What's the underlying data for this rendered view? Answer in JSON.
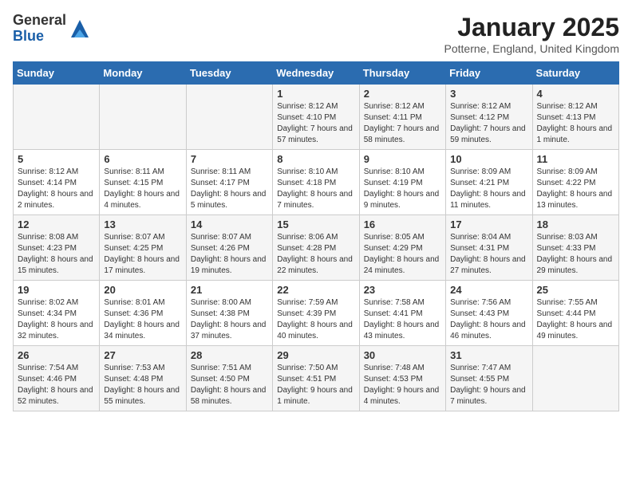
{
  "header": {
    "logo_general": "General",
    "logo_blue": "Blue",
    "title": "January 2025",
    "location": "Potterne, England, United Kingdom"
  },
  "days_of_week": [
    "Sunday",
    "Monday",
    "Tuesday",
    "Wednesday",
    "Thursday",
    "Friday",
    "Saturday"
  ],
  "weeks": [
    [
      {
        "day": "",
        "info": ""
      },
      {
        "day": "",
        "info": ""
      },
      {
        "day": "",
        "info": ""
      },
      {
        "day": "1",
        "info": "Sunrise: 8:12 AM\nSunset: 4:10 PM\nDaylight: 7 hours and 57 minutes."
      },
      {
        "day": "2",
        "info": "Sunrise: 8:12 AM\nSunset: 4:11 PM\nDaylight: 7 hours and 58 minutes."
      },
      {
        "day": "3",
        "info": "Sunrise: 8:12 AM\nSunset: 4:12 PM\nDaylight: 7 hours and 59 minutes."
      },
      {
        "day": "4",
        "info": "Sunrise: 8:12 AM\nSunset: 4:13 PM\nDaylight: 8 hours and 1 minute."
      }
    ],
    [
      {
        "day": "5",
        "info": "Sunrise: 8:12 AM\nSunset: 4:14 PM\nDaylight: 8 hours and 2 minutes."
      },
      {
        "day": "6",
        "info": "Sunrise: 8:11 AM\nSunset: 4:15 PM\nDaylight: 8 hours and 4 minutes."
      },
      {
        "day": "7",
        "info": "Sunrise: 8:11 AM\nSunset: 4:17 PM\nDaylight: 8 hours and 5 minutes."
      },
      {
        "day": "8",
        "info": "Sunrise: 8:10 AM\nSunset: 4:18 PM\nDaylight: 8 hours and 7 minutes."
      },
      {
        "day": "9",
        "info": "Sunrise: 8:10 AM\nSunset: 4:19 PM\nDaylight: 8 hours and 9 minutes."
      },
      {
        "day": "10",
        "info": "Sunrise: 8:09 AM\nSunset: 4:21 PM\nDaylight: 8 hours and 11 minutes."
      },
      {
        "day": "11",
        "info": "Sunrise: 8:09 AM\nSunset: 4:22 PM\nDaylight: 8 hours and 13 minutes."
      }
    ],
    [
      {
        "day": "12",
        "info": "Sunrise: 8:08 AM\nSunset: 4:23 PM\nDaylight: 8 hours and 15 minutes."
      },
      {
        "day": "13",
        "info": "Sunrise: 8:07 AM\nSunset: 4:25 PM\nDaylight: 8 hours and 17 minutes."
      },
      {
        "day": "14",
        "info": "Sunrise: 8:07 AM\nSunset: 4:26 PM\nDaylight: 8 hours and 19 minutes."
      },
      {
        "day": "15",
        "info": "Sunrise: 8:06 AM\nSunset: 4:28 PM\nDaylight: 8 hours and 22 minutes."
      },
      {
        "day": "16",
        "info": "Sunrise: 8:05 AM\nSunset: 4:29 PM\nDaylight: 8 hours and 24 minutes."
      },
      {
        "day": "17",
        "info": "Sunrise: 8:04 AM\nSunset: 4:31 PM\nDaylight: 8 hours and 27 minutes."
      },
      {
        "day": "18",
        "info": "Sunrise: 8:03 AM\nSunset: 4:33 PM\nDaylight: 8 hours and 29 minutes."
      }
    ],
    [
      {
        "day": "19",
        "info": "Sunrise: 8:02 AM\nSunset: 4:34 PM\nDaylight: 8 hours and 32 minutes."
      },
      {
        "day": "20",
        "info": "Sunrise: 8:01 AM\nSunset: 4:36 PM\nDaylight: 8 hours and 34 minutes."
      },
      {
        "day": "21",
        "info": "Sunrise: 8:00 AM\nSunset: 4:38 PM\nDaylight: 8 hours and 37 minutes."
      },
      {
        "day": "22",
        "info": "Sunrise: 7:59 AM\nSunset: 4:39 PM\nDaylight: 8 hours and 40 minutes."
      },
      {
        "day": "23",
        "info": "Sunrise: 7:58 AM\nSunset: 4:41 PM\nDaylight: 8 hours and 43 minutes."
      },
      {
        "day": "24",
        "info": "Sunrise: 7:56 AM\nSunset: 4:43 PM\nDaylight: 8 hours and 46 minutes."
      },
      {
        "day": "25",
        "info": "Sunrise: 7:55 AM\nSunset: 4:44 PM\nDaylight: 8 hours and 49 minutes."
      }
    ],
    [
      {
        "day": "26",
        "info": "Sunrise: 7:54 AM\nSunset: 4:46 PM\nDaylight: 8 hours and 52 minutes."
      },
      {
        "day": "27",
        "info": "Sunrise: 7:53 AM\nSunset: 4:48 PM\nDaylight: 8 hours and 55 minutes."
      },
      {
        "day": "28",
        "info": "Sunrise: 7:51 AM\nSunset: 4:50 PM\nDaylight: 8 hours and 58 minutes."
      },
      {
        "day": "29",
        "info": "Sunrise: 7:50 AM\nSunset: 4:51 PM\nDaylight: 9 hours and 1 minute."
      },
      {
        "day": "30",
        "info": "Sunrise: 7:48 AM\nSunset: 4:53 PM\nDaylight: 9 hours and 4 minutes."
      },
      {
        "day": "31",
        "info": "Sunrise: 7:47 AM\nSunset: 4:55 PM\nDaylight: 9 hours and 7 minutes."
      },
      {
        "day": "",
        "info": ""
      }
    ]
  ]
}
